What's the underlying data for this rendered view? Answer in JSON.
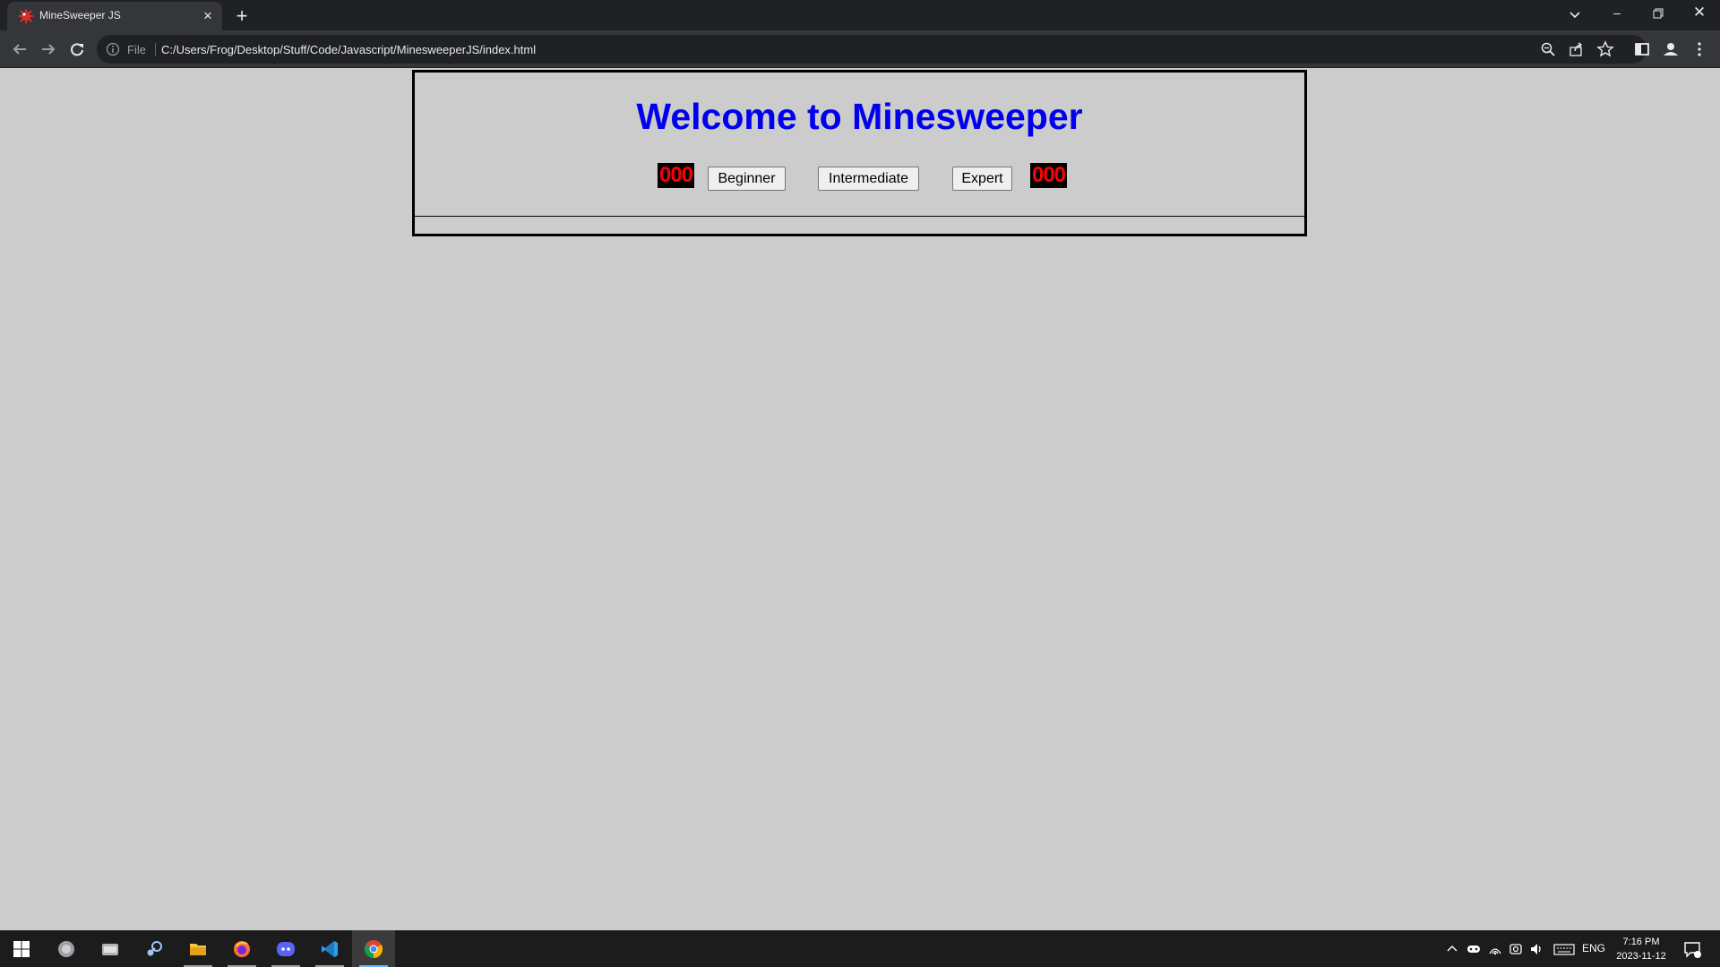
{
  "browser": {
    "tab_title": "MineSweeper JS",
    "address_scheme": "File",
    "url": "C:/Users/Frog/Desktop/Stuff/Code/Javascript/MinesweeperJS/index.html",
    "icons": [
      "back-arrow-icon",
      "forward-arrow-icon",
      "reload-icon",
      "info-icon",
      "zoom-icon",
      "share-icon",
      "star-icon",
      "side-panel-icon",
      "profile-icon",
      "menu-icon"
    ]
  },
  "page": {
    "title": "Welcome to Minesweeper",
    "mine_counter": "000",
    "timer": "000",
    "buttons": {
      "beginner": "Beginner",
      "intermediate": "Intermediate",
      "expert": "Expert"
    },
    "colors": {
      "background": "#cccccc",
      "title": "#0000ee",
      "counter_bg": "#000000",
      "counter_text": "#ff0000"
    }
  },
  "taskbar": {
    "apps": [
      "windows-start",
      "app-1",
      "app-2",
      "steam",
      "file-explorer",
      "firefox",
      "discord",
      "vscode",
      "chrome"
    ],
    "language": "ENG",
    "time": "7:16 PM",
    "date": "2023-11-12"
  }
}
